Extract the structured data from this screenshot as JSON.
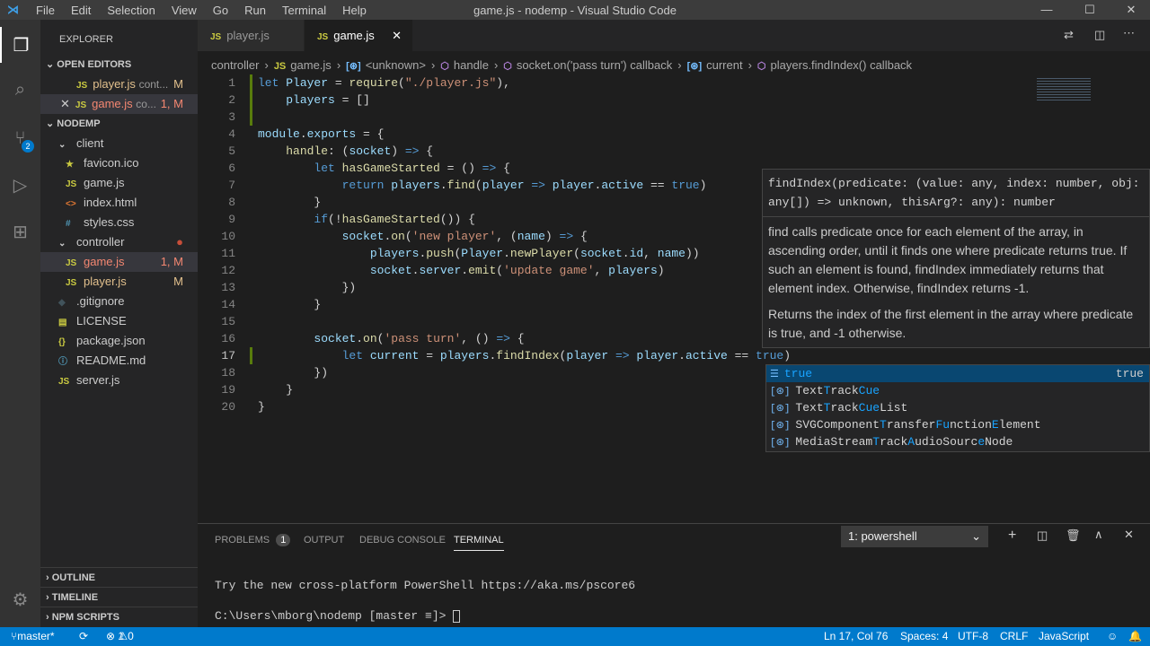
{
  "titlebar": {
    "menus": [
      "File",
      "Edit",
      "Selection",
      "View",
      "Go",
      "Run",
      "Terminal",
      "Help"
    ],
    "title": "game.js - nodemp - Visual Studio Code"
  },
  "activity": {
    "scm_badge": "2"
  },
  "sidebar": {
    "header": "EXPLORER",
    "open_editors": "OPEN EDITORS",
    "open": [
      {
        "name": "player.js",
        "hint": "cont...",
        "tag": "M"
      },
      {
        "name": "game.js",
        "hint": "co...",
        "tag": "1, M"
      }
    ],
    "project": "NODEMP",
    "tree": [
      {
        "name": "client",
        "type": "folder",
        "indent": 1
      },
      {
        "name": "favicon.ico",
        "type": "star",
        "indent": 2
      },
      {
        "name": "game.js",
        "type": "js",
        "indent": 2
      },
      {
        "name": "index.html",
        "type": "html",
        "indent": 2
      },
      {
        "name": "styles.css",
        "type": "css",
        "indent": 2
      },
      {
        "name": "controller",
        "type": "folder",
        "indent": 1,
        "dot": true
      },
      {
        "name": "game.js",
        "type": "js",
        "indent": 2,
        "tag": "1, M",
        "sel": true
      },
      {
        "name": "player.js",
        "type": "js",
        "indent": 2,
        "tag": "M"
      },
      {
        "name": ".gitignore",
        "type": "git",
        "indent": 1
      },
      {
        "name": "LICENSE",
        "type": "lic",
        "indent": 1
      },
      {
        "name": "package.json",
        "type": "json",
        "indent": 1
      },
      {
        "name": "README.md",
        "type": "md",
        "indent": 1
      },
      {
        "name": "server.js",
        "type": "js",
        "indent": 1
      }
    ],
    "bottom": [
      "OUTLINE",
      "TIMELINE",
      "NPM SCRIPTS"
    ]
  },
  "tabs": [
    {
      "name": "player.js"
    },
    {
      "name": "game.js"
    }
  ],
  "breadcrumbs": [
    "controller",
    "game.js",
    "<unknown>",
    "handle",
    "socket.on('pass turn') callback",
    "current",
    "players.findIndex() callback"
  ],
  "code": [
    [
      [
        "kw",
        "let "
      ],
      [
        "vr",
        "Player"
      ],
      [
        "pl",
        " = "
      ],
      [
        "fn",
        "require"
      ],
      [
        "pl",
        "("
      ],
      [
        "st",
        "\"./player.js\""
      ],
      [
        "pl",
        "),"
      ]
    ],
    [
      [
        "pl",
        "    "
      ],
      [
        "vr",
        "players"
      ],
      [
        "pl",
        " = []"
      ]
    ],
    [],
    [
      [
        "vr",
        "module"
      ],
      [
        "pl",
        "."
      ],
      [
        "vr",
        "exports"
      ],
      [
        "pl",
        " = {"
      ]
    ],
    [
      [
        "pl",
        "    "
      ],
      [
        "fn",
        "handle"
      ],
      [
        "pl",
        ": ("
      ],
      [
        "vr",
        "socket"
      ],
      [
        "pl",
        ") "
      ],
      [
        "kw",
        "=>"
      ],
      [
        "pl",
        " {"
      ]
    ],
    [
      [
        "pl",
        "        "
      ],
      [
        "kw",
        "let "
      ],
      [
        "fn",
        "hasGameStarted"
      ],
      [
        "pl",
        " = () "
      ],
      [
        "kw",
        "=>"
      ],
      [
        "pl",
        " {"
      ]
    ],
    [
      [
        "pl",
        "            "
      ],
      [
        "kw",
        "return "
      ],
      [
        "vr",
        "players"
      ],
      [
        "pl",
        "."
      ],
      [
        "fn",
        "find"
      ],
      [
        "pl",
        "("
      ],
      [
        "vr",
        "player"
      ],
      [
        "pl",
        " "
      ],
      [
        "kw",
        "=>"
      ],
      [
        "pl",
        " "
      ],
      [
        "vr",
        "player"
      ],
      [
        "pl",
        "."
      ],
      [
        "vr",
        "active"
      ],
      [
        "pl",
        " == "
      ],
      [
        "kw",
        "true"
      ],
      [
        "pl",
        ")"
      ]
    ],
    [
      [
        "pl",
        "        }"
      ]
    ],
    [
      [
        "pl",
        "        "
      ],
      [
        "kw",
        "if"
      ],
      [
        "pl",
        "(!"
      ],
      [
        "fn",
        "hasGameStarted"
      ],
      [
        "pl",
        "()) {"
      ]
    ],
    [
      [
        "pl",
        "            "
      ],
      [
        "vr",
        "socket"
      ],
      [
        "pl",
        "."
      ],
      [
        "fn",
        "on"
      ],
      [
        "pl",
        "("
      ],
      [
        "st",
        "'new player'"
      ],
      [
        "pl",
        ", ("
      ],
      [
        "vr",
        "name"
      ],
      [
        "pl",
        ") "
      ],
      [
        "kw",
        "=>"
      ],
      [
        "pl",
        " {"
      ]
    ],
    [
      [
        "pl",
        "                "
      ],
      [
        "vr",
        "players"
      ],
      [
        "pl",
        "."
      ],
      [
        "fn",
        "push"
      ],
      [
        "pl",
        "("
      ],
      [
        "vr",
        "Player"
      ],
      [
        "pl",
        "."
      ],
      [
        "fn",
        "newPlayer"
      ],
      [
        "pl",
        "("
      ],
      [
        "vr",
        "socket"
      ],
      [
        "pl",
        "."
      ],
      [
        "vr",
        "id"
      ],
      [
        "pl",
        ", "
      ],
      [
        "vr",
        "name"
      ],
      [
        "pl",
        "))"
      ]
    ],
    [
      [
        "pl",
        "                "
      ],
      [
        "vr",
        "socket"
      ],
      [
        "pl",
        "."
      ],
      [
        "vr",
        "server"
      ],
      [
        "pl",
        "."
      ],
      [
        "fn",
        "emit"
      ],
      [
        "pl",
        "("
      ],
      [
        "st",
        "'update game'"
      ],
      [
        "pl",
        ", "
      ],
      [
        "vr",
        "players"
      ],
      [
        "pl",
        ")"
      ]
    ],
    [
      [
        "pl",
        "            })"
      ]
    ],
    [
      [
        "pl",
        "        }"
      ]
    ],
    [],
    [
      [
        "pl",
        "        "
      ],
      [
        "vr",
        "socket"
      ],
      [
        "pl",
        "."
      ],
      [
        "fn",
        "on"
      ],
      [
        "pl",
        "("
      ],
      [
        "st",
        "'pass turn'"
      ],
      [
        "pl",
        ", () "
      ],
      [
        "kw",
        "=>"
      ],
      [
        "pl",
        " {"
      ]
    ],
    [
      [
        "pl",
        "            "
      ],
      [
        "kw",
        "let "
      ],
      [
        "vr",
        "current"
      ],
      [
        "pl",
        " = "
      ],
      [
        "vr",
        "players"
      ],
      [
        "pl",
        "."
      ],
      [
        "fn",
        "findIndex"
      ],
      [
        "pl",
        "("
      ],
      [
        "vr",
        "player"
      ],
      [
        "pl",
        " "
      ],
      [
        "kw",
        "=>"
      ],
      [
        "pl",
        " "
      ],
      [
        "vr",
        "player"
      ],
      [
        "pl",
        "."
      ],
      [
        "vr",
        "active"
      ],
      [
        "pl",
        " == "
      ],
      [
        "kw",
        "true"
      ],
      [
        "pl",
        ")"
      ]
    ],
    [
      [
        "pl",
        "        })"
      ]
    ],
    [
      [
        "pl",
        "    }"
      ]
    ],
    [
      [
        "pl",
        "}"
      ]
    ]
  ],
  "hover": {
    "signature": "findIndex(predicate: (value: any, index: number, obj: any[]) => unknown, thisArg?: any): number",
    "doc1": "find calls predicate once for each element of the array, in ascending order, until it finds one where predicate returns true. If such an element is found, findIndex immediately returns that element index. Otherwise, findIndex returns -1.",
    "doc2": "Returns the index of the first element in the array where predicate is true, and -1 otherwise."
  },
  "suggest": [
    {
      "parts": [
        [
          "",
          "true"
        ]
      ],
      "detail": "true",
      "kind": "keyword"
    },
    {
      "parts": [
        [
          "",
          "Text"
        ],
        [
          "h",
          "T"
        ],
        [
          "",
          "rack"
        ],
        [
          "h",
          "Cue"
        ]
      ],
      "kind": "variable"
    },
    {
      "parts": [
        [
          "",
          "Text"
        ],
        [
          "h",
          "T"
        ],
        [
          "",
          "rack"
        ],
        [
          "h",
          "Cue"
        ],
        [
          "",
          "List"
        ]
      ],
      "kind": "variable"
    },
    {
      "parts": [
        [
          "",
          "SVGComponent"
        ],
        [
          "h",
          "T"
        ],
        [
          "",
          "rans"
        ],
        [
          "",
          "fer"
        ],
        [
          "h",
          "Fu"
        ],
        [
          "",
          "nction"
        ],
        [
          "h",
          "E"
        ],
        [
          "",
          "lement"
        ]
      ],
      "kind": "variable"
    },
    {
      "parts": [
        [
          "",
          "MediaStream"
        ],
        [
          "h",
          "T"
        ],
        [
          "",
          "rack"
        ],
        [
          "h",
          "A"
        ],
        [
          "",
          "udioSourc"
        ],
        [
          "h",
          "e"
        ],
        [
          "",
          "Node"
        ]
      ],
      "kind": "variable"
    }
  ],
  "panel": {
    "tabs": [
      "PROBLEMS",
      "OUTPUT",
      "DEBUG CONSOLE",
      "TERMINAL"
    ],
    "problems_count": "1",
    "terminal_select": "1: powershell",
    "lines": [
      "Try the new cross-platform PowerShell https://aka.ms/pscore6",
      "C:\\Users\\mborg\\nodemp [master ≡]> "
    ]
  },
  "status": {
    "branch": "master*",
    "errors": "1",
    "warnings": "0",
    "position": "Ln 17, Col 76",
    "spaces": "Spaces: 4",
    "encoding": "UTF-8",
    "eol": "CRLF",
    "language": "JavaScript"
  }
}
